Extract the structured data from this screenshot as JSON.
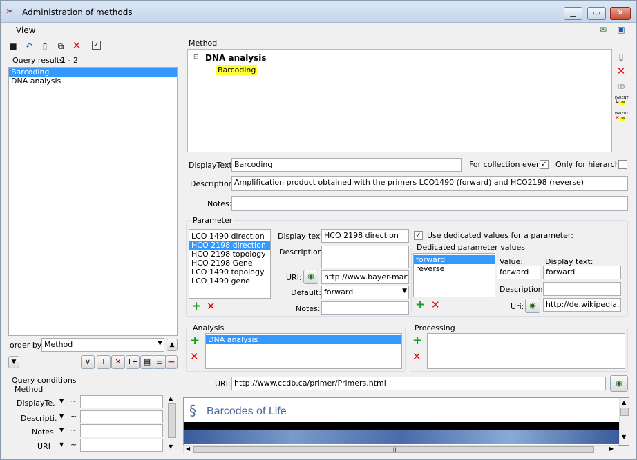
{
  "window": {
    "title": "Administration of methods"
  },
  "menu": {
    "view": "View"
  },
  "left": {
    "query_results_label": "Query results",
    "query_results_count": "1 - 2",
    "results": [
      "Barcoding",
      "DNA analysis"
    ],
    "order_by_label": "order by:",
    "order_by_value": "Method",
    "query_conditions_label": "Query conditions",
    "method_label": "Method",
    "conditions": [
      {
        "label": "DisplayTe.",
        "op": "~"
      },
      {
        "label": "Descripti.",
        "op": "~"
      },
      {
        "label": "Notes",
        "op": "~"
      },
      {
        "label": "URI",
        "op": "~"
      }
    ]
  },
  "method": {
    "group_label": "Method",
    "tree_root": "DNA analysis",
    "tree_child": "Barcoding",
    "display_text_label": "DisplayText:",
    "display_text_value": "Barcoding",
    "for_collection_event_label": "For collection event",
    "only_for_hierarchy_label": "Only for hierarchy",
    "description_label": "Description:",
    "description_value": "Amplification product obtained with the primers LCO1490 (forward) and HCO2198 (reverse)",
    "notes_label": "Notes:",
    "notes_value": "",
    "side_id": "ID",
    "side_parent": "PARENT",
    "side_parent_tag": "ON"
  },
  "parameter": {
    "group_label": "Parameter",
    "items": [
      "LCO 1490 direction",
      "HCO 2198 direction",
      "HCO 2198 topology",
      "HCO 2198 Gene",
      "LCO 1490 topology",
      "LCO 1490 gene"
    ],
    "display_text_label": "Display text:",
    "display_text_value": "HCO 2198 direction",
    "description_label": "Description:",
    "uri_label": "URI:",
    "uri_value": "http://www.bayer-martin.c",
    "default_label": "Default:",
    "default_value": "forward",
    "notes_label": "Notes:",
    "use_dedicated_label": "Use dedicated values for a parameter:",
    "dedicated_group_label": "Dedicated parameter values",
    "dedicated_items": [
      "forward",
      "reverse"
    ],
    "value_label": "Value:",
    "value_value": "forward",
    "dp_display_text_label": "Display text:",
    "dp_display_text_value": "forward",
    "dp_description_label": "Description:",
    "dp_uri_label": "Uri:",
    "dp_uri_value": "http://de.wikipedia.org"
  },
  "analysis": {
    "group_label": "Analysis",
    "items": [
      "DNA analysis"
    ]
  },
  "processing": {
    "group_label": "Processing"
  },
  "uri": {
    "label": "URI:",
    "value": "http://www.ccdb.ca/primer/Primers.html"
  },
  "browser": {
    "logo_text": "Barcodes of Life"
  }
}
